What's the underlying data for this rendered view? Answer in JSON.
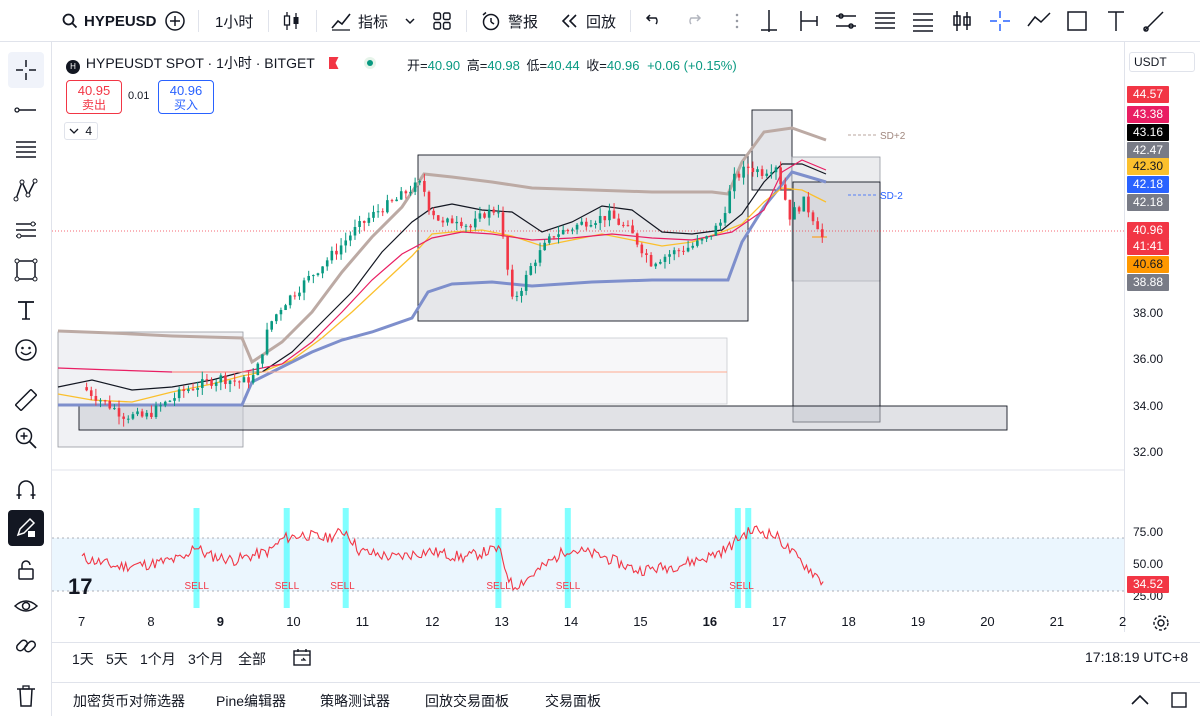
{
  "topbar": {
    "symbol": "HYPEUSD",
    "interval": "1小时",
    "indicators_label": "指标",
    "alert_label": "警报",
    "replay_label": "回放"
  },
  "legend": {
    "title": "HYPEUSDT SPOT · 1小时 · BITGET",
    "open_label": "开=",
    "open": "40.90",
    "high_label": "高=",
    "high": "40.98",
    "low_label": "低=",
    "low": "40.44",
    "close_label": "收=",
    "close": "40.96",
    "change": "+0.06 (+0.15%)",
    "sell_price": "40.95",
    "sell_label": "卖出",
    "spread": "0.01",
    "buy_price": "40.96",
    "buy_label": "买入",
    "indicator_count": "4"
  },
  "annotations": {
    "sd_plus": "SD+2",
    "sd_minus": "SD-2",
    "sell_signal": "SELL"
  },
  "price_axis": {
    "currency": "USDT",
    "ticks": [
      "38.00",
      "36.00",
      "34.00",
      "32.00"
    ],
    "labels": [
      {
        "text": "44.57",
        "color": "#f23645"
      },
      {
        "text": "43.38",
        "color": "#e91e63"
      },
      {
        "text": "43.16",
        "color": "#000000"
      },
      {
        "text": "42.47",
        "color": "#787b86"
      },
      {
        "text": "42.30",
        "color": "#fbc02d",
        "textColor": "#131722"
      },
      {
        "text": "42.18",
        "color": "#2962ff"
      },
      {
        "text": "42.18",
        "color": "#787b86"
      },
      {
        "text": "40.96",
        "color": "#f23645"
      },
      {
        "text": "41:41",
        "color": "#f23645"
      },
      {
        "text": "40.68",
        "color": "#ff9800",
        "textColor": "#131722"
      },
      {
        "text": "38.88",
        "color": "#787b86"
      }
    ],
    "rsi_ticks": [
      "75.00",
      "50.00",
      "25.00"
    ],
    "rsi_value": "34.52"
  },
  "date_axis": {
    "ticks": [
      "7",
      "8",
      "9",
      "10",
      "11",
      "12",
      "13",
      "14",
      "15",
      "16",
      "17",
      "18",
      "19",
      "20",
      "21",
      "2"
    ]
  },
  "range_bar": {
    "items": [
      "1天",
      "5天",
      "1个月",
      "3个月",
      "全部"
    ],
    "clock": "17:18:19 UTC+8"
  },
  "bottom_bar": {
    "items": [
      "加密货币对筛选器",
      "Pine编辑器",
      "策略测试器",
      "回放交易面板",
      "交易面板"
    ]
  },
  "chart_data": {
    "type": "candlestick",
    "title": "HYPEUSDT SPOT · 1小时 · BITGET",
    "ylim": [
      31.5,
      44.9
    ],
    "x_ticks": [
      "7",
      "8",
      "9",
      "10",
      "11",
      "12",
      "13",
      "14",
      "15",
      "16",
      "17",
      "18",
      "19",
      "20",
      "21",
      "2"
    ],
    "price_path": [
      [
        7.0,
        34.8
      ],
      [
        7.3,
        34.2
      ],
      [
        7.6,
        33.6
      ],
      [
        7.9,
        33.5
      ],
      [
        8.2,
        34.1
      ],
      [
        8.5,
        34.7
      ],
      [
        8.8,
        35.0
      ],
      [
        9.0,
        35.2
      ],
      [
        9.3,
        35.0
      ],
      [
        9.5,
        35.3
      ],
      [
        9.7,
        37.5
      ],
      [
        9.9,
        38.4
      ],
      [
        10.1,
        39.0
      ],
      [
        10.3,
        39.6
      ],
      [
        10.5,
        40.2
      ],
      [
        10.7,
        40.8
      ],
      [
        10.9,
        41.5
      ],
      [
        11.1,
        42.0
      ],
      [
        11.3,
        42.5
      ],
      [
        11.5,
        42.8
      ],
      [
        11.7,
        43.3
      ],
      [
        11.9,
        43.6
      ],
      [
        12.0,
        42.6
      ],
      [
        12.2,
        41.8
      ],
      [
        12.4,
        42.1
      ],
      [
        12.6,
        41.7
      ],
      [
        12.8,
        42.3
      ],
      [
        13.0,
        42.5
      ],
      [
        13.2,
        38.5
      ],
      [
        13.35,
        39.2
      ],
      [
        13.5,
        40.2
      ],
      [
        13.8,
        41.4
      ],
      [
        14.0,
        41.6
      ],
      [
        14.3,
        42.0
      ],
      [
        14.6,
        42.2
      ],
      [
        14.9,
        41.5
      ],
      [
        15.2,
        40.2
      ],
      [
        15.5,
        40.6
      ],
      [
        15.8,
        40.9
      ],
      [
        16.0,
        41.2
      ],
      [
        16.2,
        41.9
      ],
      [
        16.4,
        43.8
      ],
      [
        16.6,
        44.3
      ],
      [
        16.8,
        44.1
      ],
      [
        17.0,
        44.4
      ],
      [
        17.2,
        42.2
      ],
      [
        17.4,
        42.8
      ],
      [
        17.6,
        41.8
      ],
      [
        17.7,
        40.96
      ]
    ],
    "rsi": [
      [
        7.0,
        55
      ],
      [
        7.5,
        48
      ],
      [
        8.0,
        50
      ],
      [
        8.5,
        55
      ],
      [
        8.6,
        65
      ],
      [
        8.8,
        57
      ],
      [
        9.2,
        53
      ],
      [
        9.7,
        60
      ],
      [
        9.9,
        70
      ],
      [
        10.2,
        73
      ],
      [
        10.5,
        70
      ],
      [
        10.8,
        76
      ],
      [
        11.0,
        60
      ],
      [
        11.5,
        55
      ],
      [
        12.0,
        60
      ],
      [
        12.5,
        55
      ],
      [
        13.0,
        62
      ],
      [
        13.2,
        32
      ],
      [
        13.4,
        38
      ],
      [
        14.0,
        62
      ],
      [
        14.5,
        56
      ],
      [
        15.0,
        45
      ],
      [
        15.5,
        48
      ],
      [
        16.0,
        55
      ],
      [
        16.3,
        62
      ],
      [
        16.5,
        72
      ],
      [
        16.7,
        77
      ],
      [
        17.0,
        72
      ],
      [
        17.3,
        55
      ],
      [
        17.6,
        40
      ],
      [
        17.7,
        34.52
      ]
    ],
    "rsi_ylim": [
      20,
      85
    ],
    "levels": [
      {
        "label": "SD+2",
        "value": 44.57
      },
      {
        "label": "SD-2",
        "value": 42.18
      }
    ]
  }
}
